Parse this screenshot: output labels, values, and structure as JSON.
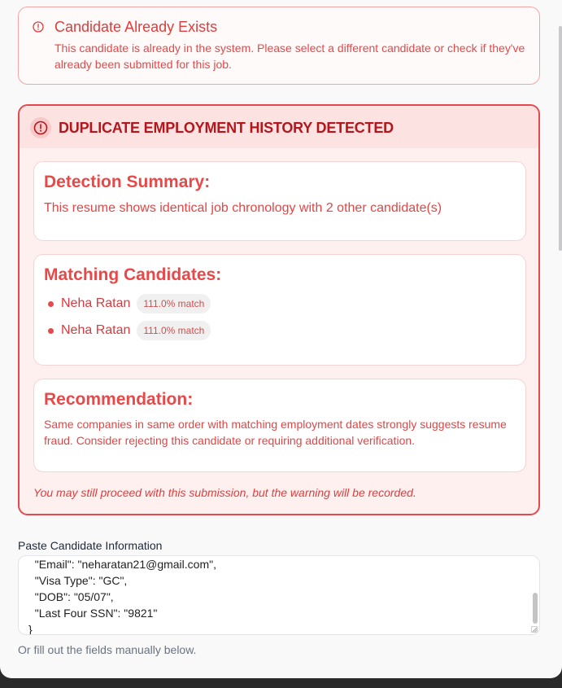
{
  "alert_exists": {
    "title": "Candidate Already Exists",
    "description": "This candidate is already in the system. Please select a different candidate or check if they've already been submitted for this job.",
    "icon": "alert-circle-icon"
  },
  "duplicate": {
    "title": "DUPLICATE EMPLOYMENT HISTORY DETECTED",
    "icon": "alert-circle-icon",
    "summary": {
      "heading": "Detection Summary:",
      "text": "This resume shows identical job chronology with 2 other candidate(s)"
    },
    "matching": {
      "heading": "Matching Candidates:",
      "candidates": [
        {
          "name": "Neha Ratan",
          "match": "111.0% match"
        },
        {
          "name": "Neha Ratan",
          "match": "111.0% match"
        }
      ]
    },
    "recommendation": {
      "heading": "Recommendation:",
      "text": "Same companies in same order with matching employment dates strongly suggests resume fraud. Consider rejecting this candidate or requiring additional verification."
    },
    "proceed_note": "You may still proceed with this submission, but the warning will be recorded."
  },
  "paste": {
    "label": "Paste Candidate Information",
    "lines": [
      "  \"Email\": \"neharatan21@gmail.com\",",
      "  \"Visa Type\": \"GC\",",
      "  \"DOB\": \"05/07\",",
      "  \"Last Four SSN\": \"9821\"",
      "}"
    ]
  },
  "manual_hint": "Or fill out the fields manually below.",
  "colors": {
    "danger": "#e5484d",
    "danger_dark": "#b3161c",
    "panel_bg": "#f9f9fa"
  }
}
